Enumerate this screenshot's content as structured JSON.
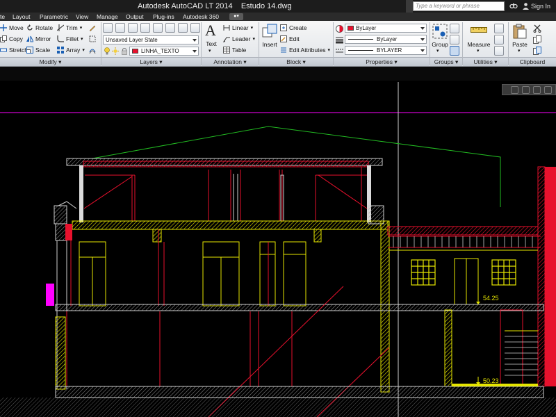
{
  "titlebar": {
    "app_title": "Autodesk AutoCAD LT 2014",
    "file_name": "Estudo 14.dwg",
    "search_placeholder": "Type a keyword or phrase",
    "sign_in": "Sign In"
  },
  "menubar": {
    "items": [
      "te",
      "Layout",
      "Parametric",
      "View",
      "Manage",
      "Output",
      "Plug-ins",
      "Autodesk 360"
    ]
  },
  "ribbon": {
    "modify": {
      "title": "Modify",
      "move": "Move",
      "rotate": "Rotate",
      "trim": "Trim",
      "copy": "Copy",
      "mirror": "Mirror",
      "fillet": "Fillet",
      "stretch": "Stretch",
      "scale": "Scale",
      "array": "Array"
    },
    "layers": {
      "title": "Layers",
      "layer_state": "Unsaved Layer State",
      "current_layer": "LINHA_TEXTO"
    },
    "annotation": {
      "title": "Annotation",
      "text": "Text",
      "linear": "Linear",
      "leader": "Leader",
      "table": "Table"
    },
    "block": {
      "title": "Block",
      "insert": "Insert",
      "create": "Create",
      "edit": "Edit",
      "edit_attributes": "Edit Attributes"
    },
    "properties": {
      "title": "Properties",
      "color": "ByLayer",
      "linetype": "ByLayer",
      "lineweight": "BYLAYER"
    },
    "groups": {
      "title": "Groups",
      "group": "Group"
    },
    "utilities": {
      "title": "Utilities",
      "measure": "Measure"
    },
    "clipboard": {
      "title": "Clipboard",
      "paste": "Paste"
    }
  },
  "drawing": {
    "level_upper": "54.25",
    "level_lower": "50.23"
  },
  "colors": {
    "background": "#000000",
    "wall_yellow": "#e6e600",
    "wall_red": "#e8112d",
    "roof_green": "#22bb22",
    "section_gray": "#bdbdbd",
    "magenta": "#ff00ff"
  }
}
